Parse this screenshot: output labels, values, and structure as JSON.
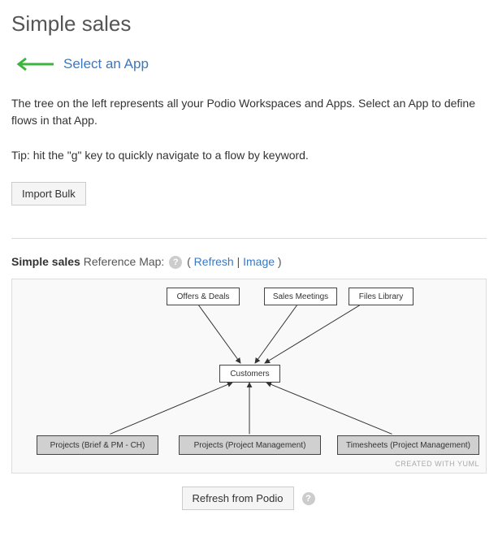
{
  "title": "Simple sales",
  "select_app_label": "Select an App",
  "intro_paragraph": "The tree on the left represents all your Podio Workspaces and Apps. Select an App to define flows in that App.",
  "tip_paragraph": "Tip: hit the \"g\" key to quickly navigate to a flow by keyword.",
  "import_bulk_label": "Import Bulk",
  "refmap": {
    "title_prefix": "Simple sales",
    "title_suffix": "Reference Map:",
    "refresh_link": "Refresh",
    "image_link": "Image"
  },
  "diagram": {
    "top_nodes": [
      "Offers & Deals",
      "Sales Meetings",
      "Files Library"
    ],
    "center_node": "Customers",
    "bottom_nodes": [
      "Projects (Brief & PM - CH)",
      "Projects (Project Management)",
      "Timesheets (Project Management)"
    ],
    "credit": "CREATED WITH YUML"
  },
  "refresh_from_podio_label": "Refresh from Podio",
  "chart_data": {
    "type": "diagram",
    "nodes": [
      {
        "id": "offers",
        "label": "Offers & Deals",
        "style": "white"
      },
      {
        "id": "meetings",
        "label": "Sales Meetings",
        "style": "white"
      },
      {
        "id": "files",
        "label": "Files Library",
        "style": "white"
      },
      {
        "id": "customers",
        "label": "Customers",
        "style": "white"
      },
      {
        "id": "proj_brief",
        "label": "Projects (Brief & PM - CH)",
        "style": "grey"
      },
      {
        "id": "proj_pm",
        "label": "Projects (Project Management)",
        "style": "grey"
      },
      {
        "id": "timesheets",
        "label": "Timesheets (Project Management)",
        "style": "grey"
      }
    ],
    "edges": [
      {
        "from": "offers",
        "to": "customers",
        "arrow": "to"
      },
      {
        "from": "meetings",
        "to": "customers",
        "arrow": "to"
      },
      {
        "from": "files",
        "to": "customers",
        "arrow": "to"
      },
      {
        "from": "proj_brief",
        "to": "customers",
        "arrow": "to"
      },
      {
        "from": "proj_pm",
        "to": "customers",
        "arrow": "to"
      },
      {
        "from": "timesheets",
        "to": "customers",
        "arrow": "to"
      }
    ]
  }
}
